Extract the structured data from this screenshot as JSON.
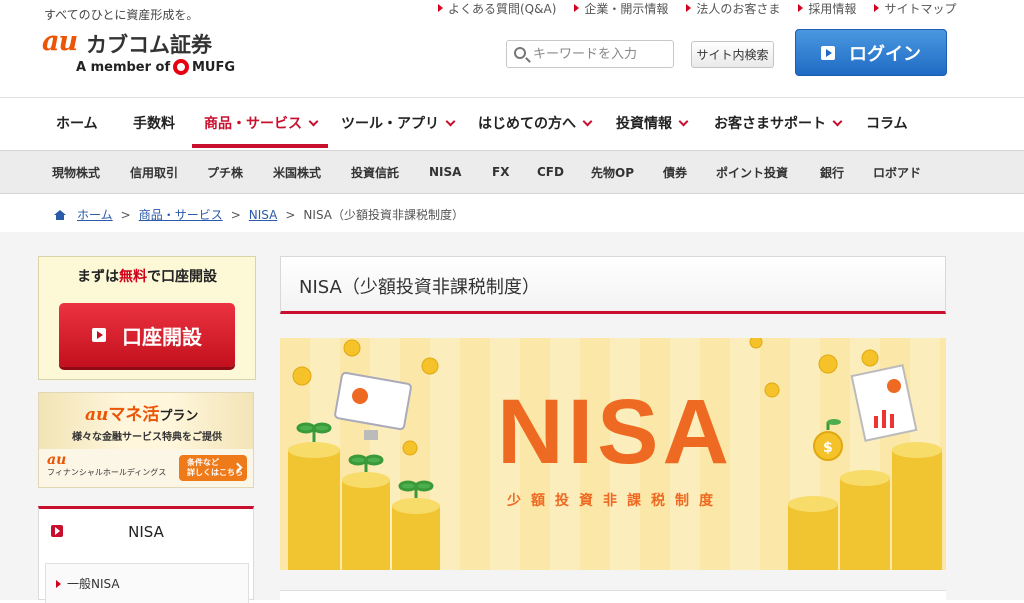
{
  "header": {
    "tagline": "すべてのひとに資産形成を。",
    "logo_au": "au",
    "logo_name": "カブコム証券",
    "logo_member": "A member of",
    "logo_mufg": "MUFG",
    "util_links": [
      "よくある質問(Q&A)",
      "企業・開示情報",
      "法人のお客さま",
      "採用情報",
      "サイトマップ"
    ],
    "search_placeholder": "キーワードを入力",
    "site_search_label": "サイト内検索",
    "login_label": "ログイン"
  },
  "gnav": {
    "items": [
      "ホーム",
      "手数料",
      "商品・サービス",
      "ツール・アプリ",
      "はじめての方へ",
      "投資情報",
      "お客さまサポート",
      "コラム"
    ]
  },
  "subnav": {
    "items": [
      "現物株式",
      "信用取引",
      "プチ株",
      "米国株式",
      "投資信託",
      "NISA",
      "FX",
      "CFD",
      "先物OP",
      "債券",
      "ポイント投資",
      "銀行",
      "ロボアド"
    ]
  },
  "breadcrumb": {
    "items": [
      "ホーム",
      "商品・サービス",
      "NISA"
    ],
    "current": "NISA（少額投資非課税制度）",
    "separator": ">"
  },
  "sidebar": {
    "open_lead_pre": "まずは",
    "open_lead_free": "無料",
    "open_lead_post": "で口座開設",
    "open_button": "口座開設",
    "banner_au": "au",
    "banner_title": "マネ活",
    "banner_plan": "プラン",
    "banner_sub": "様々な金融サービス特典をご提供",
    "banner_holdings_au": "au",
    "banner_holdings": "フィナンシャルホールディングス",
    "banner_cta_1": "条件など",
    "banner_cta_2": "詳しくはこちら",
    "menu_title": "NISA",
    "menu_sub": "一般NISA"
  },
  "main": {
    "page_title": "NISA（少額投資非課税制度）",
    "hero_title": "NISA",
    "hero_sub": "少額投資非課税制度"
  },
  "colors": {
    "brand_red": "#c8102e",
    "au_orange": "#eb5505",
    "login_blue": "#1f6bc4",
    "hero_bg": "#fbe7a7",
    "hero_text": "#ee6a22"
  }
}
